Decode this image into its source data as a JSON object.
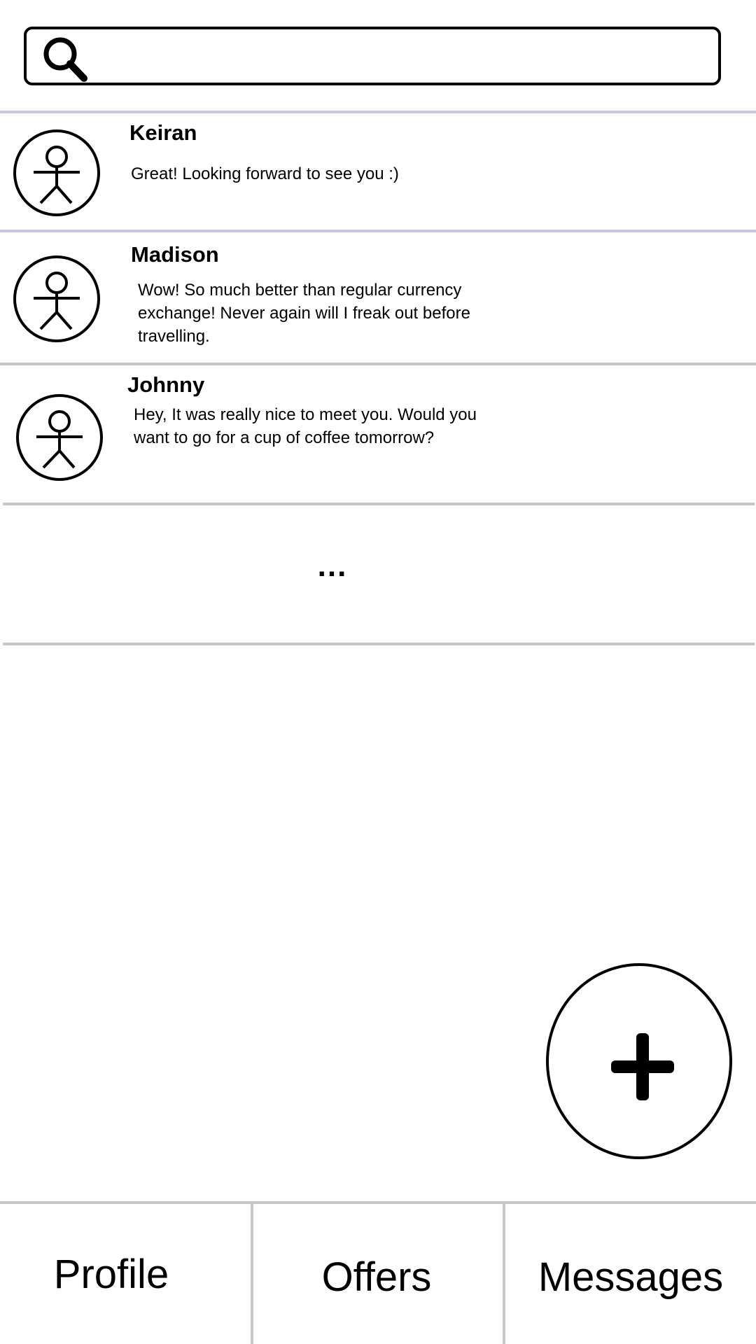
{
  "search": {
    "value": "",
    "placeholder": ""
  },
  "messages": [
    {
      "name": "Keiran",
      "preview": "Great! Looking forward to see you :)"
    },
    {
      "name": "Madison",
      "preview": "Wow! So much better than regular currency exchange! Never again will I freak out before travelling."
    },
    {
      "name": "Johnny",
      "preview": "Hey, It was really nice to meet you. Would you want to go for a cup of coffee tomorrow?"
    }
  ],
  "more": {
    "label": "..."
  },
  "nav": {
    "items": [
      {
        "label": "Profile"
      },
      {
        "label": "Offers"
      },
      {
        "label": "Messages"
      }
    ]
  },
  "icons": {
    "search": "magnifier-icon",
    "avatar": "person-icon",
    "add": "plus-icon"
  },
  "colors": {
    "accent_divider": "#c9c4e6",
    "divider": "#c6c6c6",
    "ink": "#000000",
    "background": "#ffffff"
  }
}
